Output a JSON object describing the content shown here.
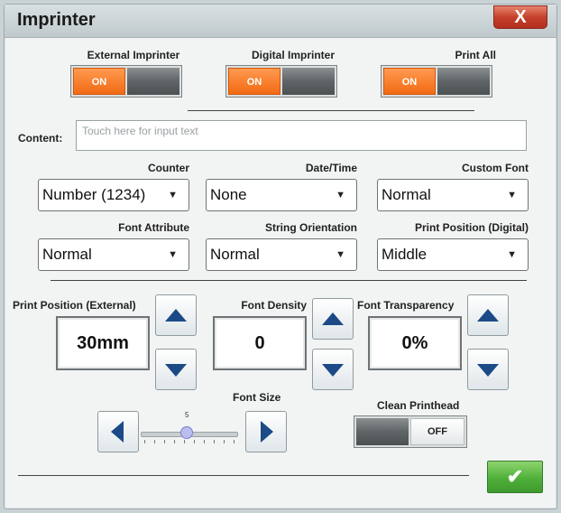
{
  "window": {
    "title": "Imprinter",
    "close_label": "X"
  },
  "toggles": [
    {
      "label": "External Imprinter",
      "state": "ON"
    },
    {
      "label": "Digital Imprinter",
      "state": "ON"
    },
    {
      "label": "Print All",
      "state": "ON"
    }
  ],
  "content": {
    "label": "Content:",
    "placeholder": "Touch here for input text",
    "value": ""
  },
  "selects": {
    "counter": {
      "label": "Counter",
      "value": "Number (1234)"
    },
    "datetime": {
      "label": "Date/Time",
      "value": "None"
    },
    "custom_font": {
      "label": "Custom Font",
      "value": "Normal"
    },
    "font_attribute": {
      "label": "Font Attribute",
      "value": "Normal"
    },
    "string_orientation": {
      "label": "String Orientation",
      "value": "Normal"
    },
    "print_position_digital": {
      "label": "Print Position (Digital)",
      "value": "Middle"
    }
  },
  "steppers": {
    "print_position_external": {
      "label": "Print Position (External)",
      "value": "30mm"
    },
    "font_density": {
      "label": "Font Density",
      "value": "0"
    },
    "font_transparency": {
      "label": "Font Transparency",
      "value": "0%"
    }
  },
  "font_size": {
    "label": "Font Size",
    "value": "5"
  },
  "clean_printhead": {
    "label": "Clean Printhead",
    "state": "OFF"
  },
  "ok": {
    "label": "✔"
  },
  "colors": {
    "toggle_on": "#f26a14",
    "arrow": "#1b4a86",
    "ok_button": "#4fb03a",
    "close_button": "#c4412b"
  },
  "icons": {
    "up": "triangle-up-icon",
    "down": "triangle-down-icon",
    "left": "triangle-left-icon",
    "right": "triangle-right-icon",
    "check": "checkmark-icon"
  }
}
